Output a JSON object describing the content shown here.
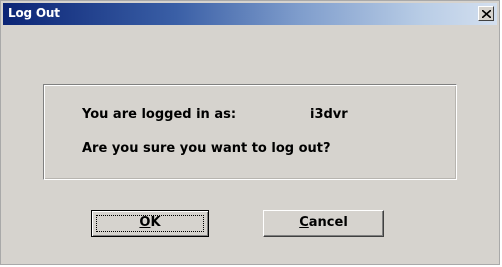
{
  "window": {
    "title": "Log Out",
    "close_icon": "close-x-icon"
  },
  "info": {
    "logged_in_label": "You are logged in as:",
    "username": "i3dvr",
    "question": "Are you sure you want to log out?"
  },
  "buttons": {
    "ok": {
      "mnemonic": "O",
      "rest": "K"
    },
    "cancel": {
      "mnemonic": "C",
      "rest": "ancel"
    }
  },
  "colors": {
    "dialog_bg": "#d6d3ce",
    "titlebar_start": "#0b2475",
    "titlebar_end": "#d3dfef"
  }
}
